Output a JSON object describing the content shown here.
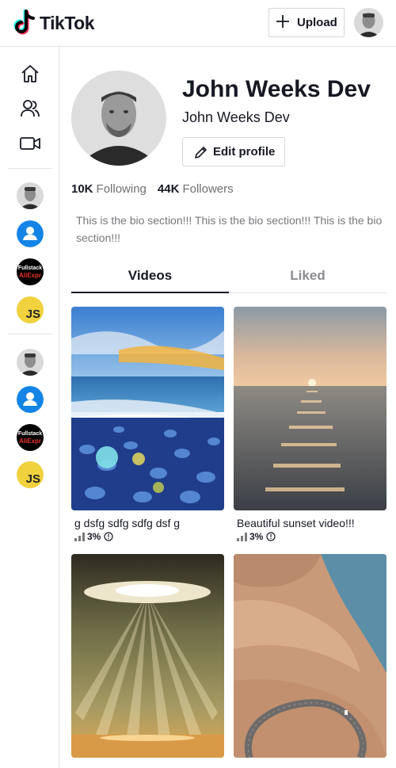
{
  "header": {
    "logo_text": "TikTok",
    "upload_label": "Upload"
  },
  "profile": {
    "name": "John Weeks Dev",
    "username": "John Weeks Dev",
    "edit_label": "Edit profile",
    "following_count": "10K",
    "following_label": "Following",
    "followers_count": "44K",
    "followers_label": "Followers",
    "bio": "This is the bio section!!! This is the bio section!!! This is the bio section!!!"
  },
  "tabs": {
    "videos": "Videos",
    "liked": "Liked"
  },
  "sidebar_avatars": {
    "fullstack_line1": "Fullstack",
    "fullstack_line2": "AliExpr",
    "js_label": "JS"
  },
  "videos": [
    {
      "title": "g dsfg sdfg sdfg dsf g",
      "percent": "3%"
    },
    {
      "title": "Beautiful sunset video!!!",
      "percent": "3%"
    },
    {
      "title": "",
      "percent": ""
    },
    {
      "title": "",
      "percent": ""
    }
  ]
}
